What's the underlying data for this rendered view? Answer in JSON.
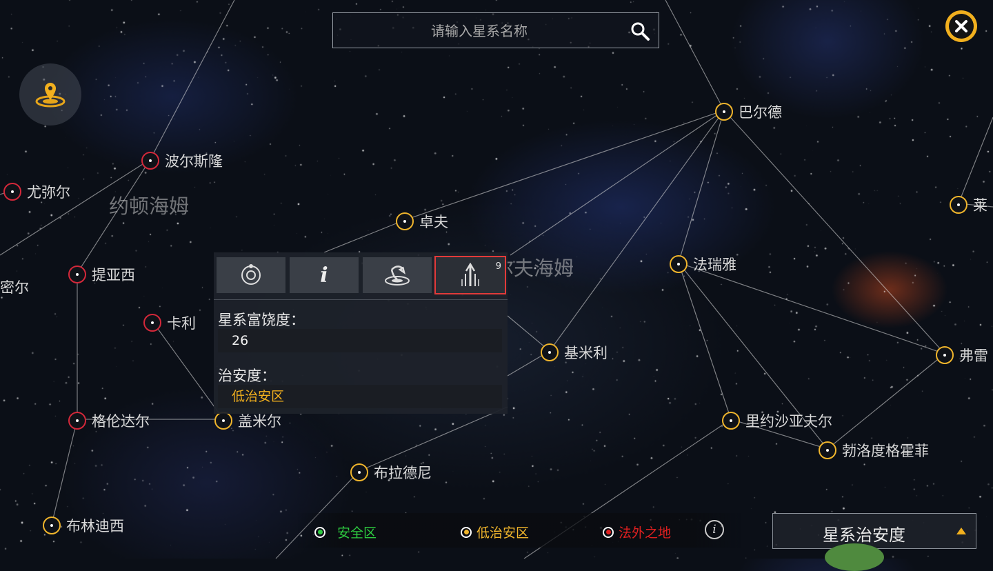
{
  "search": {
    "placeholder": "请输入星系名称",
    "icon": "search-icon"
  },
  "close_icon": "close-icon",
  "locate_icon": "location-pin-icon",
  "regions": [
    {
      "id": "region-yuedun",
      "name": "约顿海姆"
    },
    {
      "id": "region-center",
      "name": "尔夫海姆"
    }
  ],
  "systems": [
    {
      "name": "波尔斯隆",
      "security": "low",
      "danger": "red"
    },
    {
      "name": "尤弥尔",
      "security": "lawless"
    },
    {
      "name": "提亚西",
      "security": "lawless"
    },
    {
      "name": "密尔",
      "security": "low",
      "hideNode": true
    },
    {
      "name": "卡利",
      "security": "lawless"
    },
    {
      "name": "格伦达尔",
      "security": "lawless"
    },
    {
      "name": "盖米尔",
      "security": "low"
    },
    {
      "name": "布林迪西",
      "security": "low"
    },
    {
      "name": "布拉德尼",
      "security": "low"
    },
    {
      "name": "卓夫",
      "security": "low"
    },
    {
      "name": "基米利",
      "security": "low"
    },
    {
      "name": "巴尔德",
      "security": "low"
    },
    {
      "name": "法瑞雅",
      "security": "low"
    },
    {
      "name": "里约沙亚夫尔",
      "security": "low"
    },
    {
      "name": "勃洛度格霍菲",
      "security": "low"
    },
    {
      "name": "弗雷",
      "security": "low"
    },
    {
      "name": "莱",
      "security": "low"
    }
  ],
  "panel": {
    "tabs": [
      {
        "name": "planet-icon",
        "badge": ""
      },
      {
        "name": "info-icon",
        "badge": ""
      },
      {
        "name": "warp-icon",
        "badge": ""
      },
      {
        "name": "structures-icon",
        "badge": "9",
        "active": true
      }
    ],
    "richness_label": "星系富饶度：",
    "richness_value": "26",
    "security_label": "治安度：",
    "security_value": "低治安区"
  },
  "legend": {
    "items": [
      {
        "label": "安全区",
        "color": "#2ecc40"
      },
      {
        "label": "低治安区",
        "color": "#f0b52c"
      },
      {
        "label": "法外之地",
        "color": "#e02020"
      }
    ],
    "info_icon": "info-icon"
  },
  "mode_select": {
    "label": "星系治安度",
    "icon": "caret-up-icon"
  },
  "colors": {
    "accent": "#f2b01e",
    "lawless": "#d4283a",
    "safe": "#2ecc40",
    "highlight": "#e23a3a"
  }
}
